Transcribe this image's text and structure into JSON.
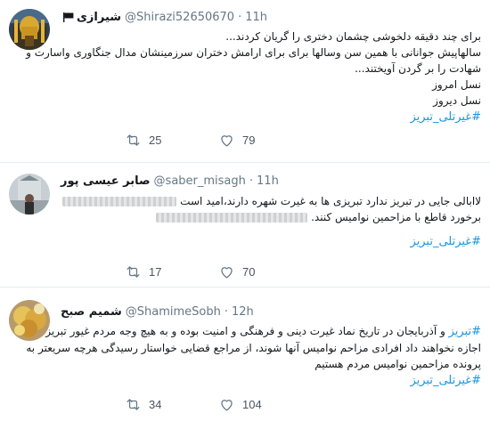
{
  "tweets": [
    {
      "name": "شیرازی",
      "handle": "@Shirazi52650670",
      "dot": "·",
      "time": "11h",
      "lines": [
        "برای چند دقیقه دلخوشی چشمان دختری را گریان کردند...",
        "سالهاپیش جوانانی با همین سن وسالها برای برای ارامش دختران سرزمینشان مدال جنگاوری  واسارت و",
        "شهادت را بر گردن آویختند...",
        "نسل امروز",
        "نسل دیروز"
      ],
      "hashtag": "#غیرتلی_تبریز",
      "retweets": "25",
      "likes": "79",
      "icons": [
        "reply-icon",
        "retweet-icon",
        "like-icon"
      ]
    },
    {
      "name": "صابر عیسی پور",
      "handle": "@saber_misagh",
      "dot": "·",
      "time": "11h",
      "lines": [
        "لاابالی جایی در تبریز ندارد تبریزی ها به غیرت شهره دارند،امید است",
        "برخورد قاطع با مزاحمین نوامیس کنند."
      ],
      "hashtag": "#غیرتلی_تبریز",
      "retweets": "17",
      "likes": "70"
    },
    {
      "name": "شمیم صبح",
      "handle": "@ShamimeSobh",
      "dot": "·",
      "time": "12h",
      "hashtag_inline": "#تبریز",
      "lines": [
        "و آذربایجان در تاریخ نماد غیرت دینی و فرهنگی و امنیت بوده و به هیچ وجه مردم غیور تبریز",
        "اجازه نخواهند داد افرادی مزاحم نوامیس آنها شوند، از مراجع قضایی خواستار رسیدگی هرچه سریعتر به",
        "پرونده مزاحمین نوامیس مردم هستیم"
      ],
      "hashtag": "#غیرتلی_تبریز",
      "retweets": "34",
      "likes": "104"
    }
  ],
  "colors": {
    "link": "#1b95e0",
    "muted": "#657786",
    "border": "#e6ecf0"
  }
}
